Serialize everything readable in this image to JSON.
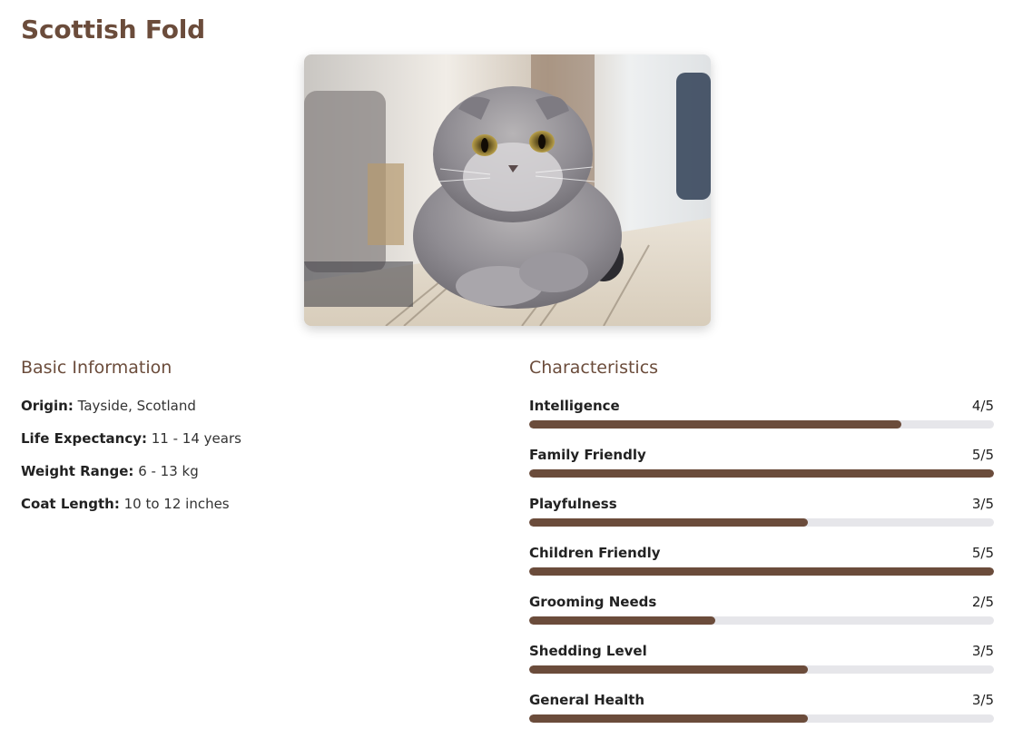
{
  "breed": {
    "title": "Scottish Fold",
    "photo_alt": "Scottish Fold"
  },
  "basic": {
    "heading": "Basic Information",
    "items": [
      {
        "label": "Origin:",
        "value": "Tayside, Scotland"
      },
      {
        "label": "Life Expectancy:",
        "value": "11 - 14 years"
      },
      {
        "label": "Weight Range:",
        "value": "6 - 13 kg"
      },
      {
        "label": "Coat Length:",
        "value": "10 to 12 inches"
      }
    ]
  },
  "characteristics": {
    "heading": "Characteristics",
    "items": [
      {
        "label": "Intelligence",
        "score_text": "4/5",
        "level": 0.8
      },
      {
        "label": "Family Friendly",
        "score_text": "5/5",
        "level": 1.0
      },
      {
        "label": "Playfulness",
        "score_text": "3/5",
        "level": 0.6
      },
      {
        "label": "Children Friendly",
        "score_text": "5/5",
        "level": 1.0
      },
      {
        "label": "Grooming Needs",
        "score_text": "2/5",
        "level": 0.4
      },
      {
        "label": "Shedding Level",
        "score_text": "3/5",
        "level": 0.6
      },
      {
        "label": "General Health",
        "score_text": "3/5",
        "level": 0.6
      }
    ]
  },
  "colors": {
    "accent": "#6b4c3b",
    "track": "#e6e6ea"
  }
}
